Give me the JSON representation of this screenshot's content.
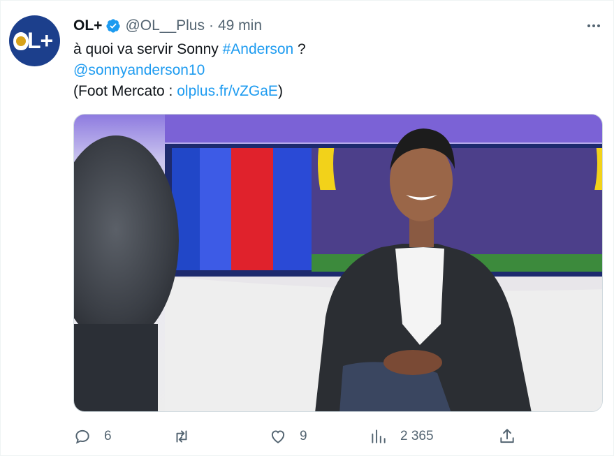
{
  "tweet": {
    "author_name": "OL+",
    "handle": "@OL__Plus",
    "separator": "·",
    "time": "49 min",
    "text_line1_prefix": "à quoi va servir Sonny ",
    "hashtag": "#Anderson",
    "text_line1_suffix": " ?",
    "mention": "@sonnyanderson10",
    "source_prefix": "(Foot Mercato : ",
    "source_link": "olplus.fr/vZGaE",
    "source_suffix": ")"
  },
  "avatar": {
    "text": "L+",
    "bg_color": "#1c3f8c"
  },
  "actions": {
    "reply_count": "6",
    "retweet_count": "",
    "like_count": "9",
    "views_count": "2 365"
  },
  "icons": {
    "verified": "verified-badge-icon",
    "more": "more-options-icon",
    "reply": "reply-icon",
    "retweet": "retweet-icon",
    "like": "heart-icon",
    "views": "views-icon",
    "share": "share-icon"
  },
  "colors": {
    "link": "#1d9bf0",
    "secondary": "#536471",
    "verified": "#1d9bf0"
  }
}
